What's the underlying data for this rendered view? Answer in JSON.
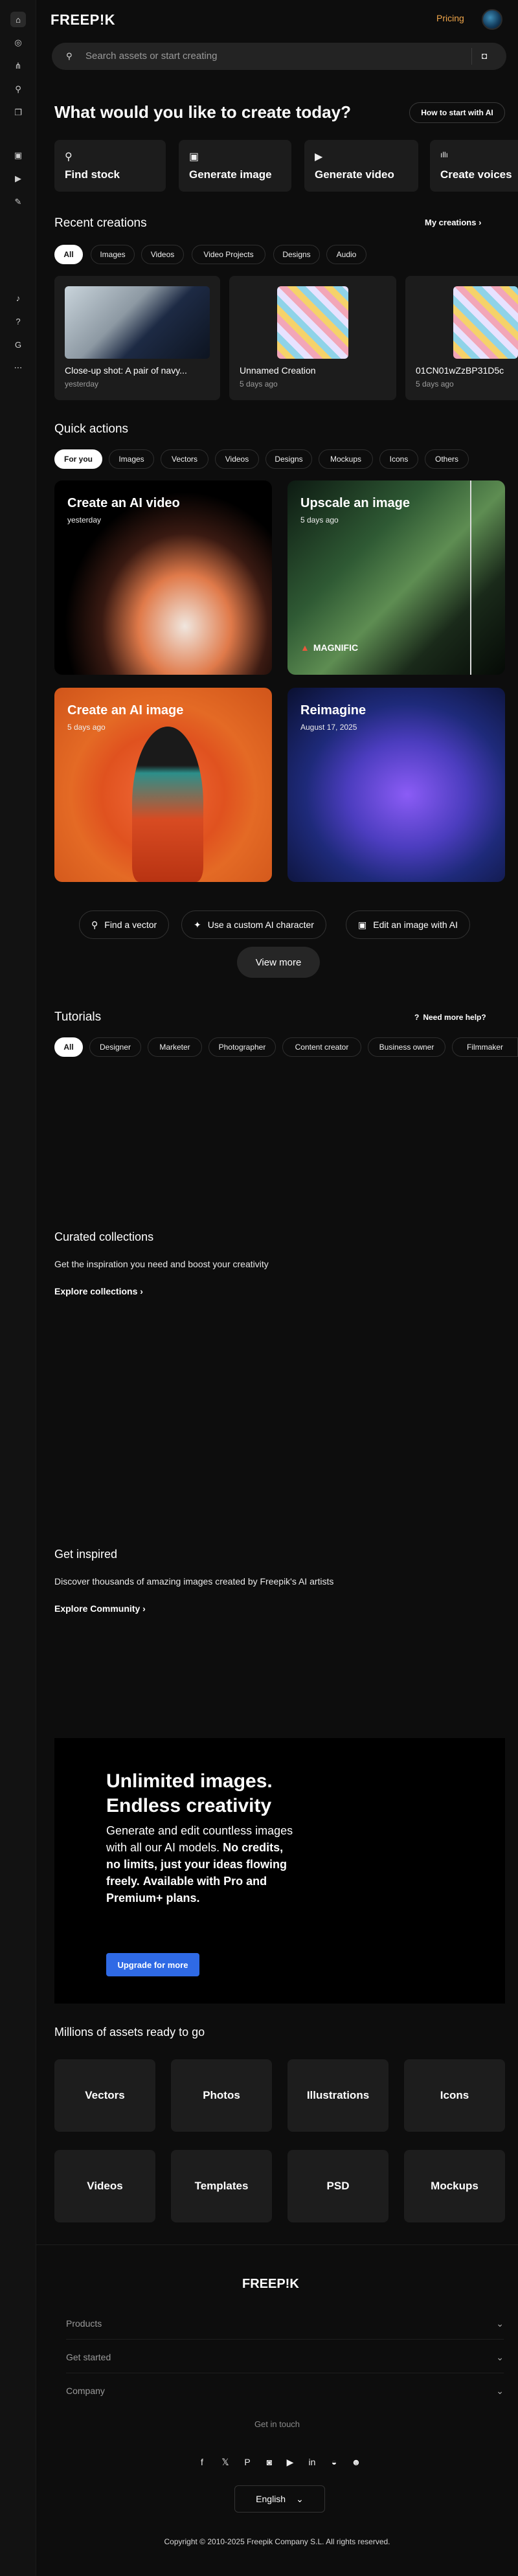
{
  "sidebar": {
    "items": [
      {
        "icon": "home-icon",
        "glyph": "⌂",
        "active": true
      },
      {
        "icon": "globe-icon",
        "glyph": "◎"
      },
      {
        "icon": "share-icon",
        "glyph": "⋔"
      },
      {
        "icon": "search-icon",
        "glyph": "⚲"
      },
      {
        "icon": "layers-icon",
        "glyph": "❐"
      },
      {
        "icon": "image-icon",
        "glyph": "▣"
      },
      {
        "icon": "video-icon",
        "glyph": "▶"
      },
      {
        "icon": "edit-icon",
        "glyph": "✎"
      },
      {
        "icon": "bell-icon",
        "glyph": "♪"
      },
      {
        "icon": "help-icon",
        "glyph": "?"
      },
      {
        "icon": "language-icon",
        "glyph": "G"
      },
      {
        "icon": "more-icon",
        "glyph": "⋯"
      }
    ]
  },
  "header": {
    "logo": "FREEP!K",
    "pricing": "Pricing"
  },
  "search": {
    "placeholder": "Search assets or start creating"
  },
  "create": {
    "title": "What would you like to create today?",
    "how_to": "How to start with AI",
    "cards": [
      {
        "label": "Find stock",
        "icon": "search-icon",
        "glyph": "⚲"
      },
      {
        "label": "Generate image",
        "icon": "image-icon",
        "glyph": "▣"
      },
      {
        "label": "Generate video",
        "icon": "video-icon",
        "glyph": "▶"
      },
      {
        "label": "Create voices",
        "icon": "waveform-icon",
        "glyph": "ıllı"
      }
    ]
  },
  "recent": {
    "title": "Recent creations",
    "my_creations": "My creations",
    "filters": [
      "All",
      "Images",
      "Videos",
      "Video Projects",
      "Designs",
      "Audio"
    ],
    "items": [
      {
        "title": "Close-up shot: A pair of navy...",
        "date": "yesterday"
      },
      {
        "title": "Unnamed Creation",
        "date": "5 days ago"
      },
      {
        "title": "01CN01wZzBP31D5c",
        "date": "5 days ago"
      }
    ]
  },
  "quick": {
    "title": "Quick actions",
    "filters": [
      "For you",
      "Images",
      "Vectors",
      "Videos",
      "Designs",
      "Mockups",
      "Icons",
      "Others"
    ],
    "cards": [
      {
        "title": "Create an AI video",
        "sub": "yesterday"
      },
      {
        "title": "Upscale an image",
        "sub": "5 days ago",
        "badge": "MAGNIFIC"
      },
      {
        "title": "Create an AI image",
        "sub": "5 days ago"
      },
      {
        "title": "Reimagine",
        "sub": "August 17, 2025"
      }
    ],
    "actions": [
      "Find a vector",
      "Use a custom AI character",
      "Edit an image with AI"
    ],
    "view_more": "View more"
  },
  "tutorials": {
    "title": "Tutorials",
    "help": "Need more help?",
    "filters": [
      "All",
      "Designer",
      "Marketer",
      "Photographer",
      "Content creator",
      "Business owner",
      "Filmmaker"
    ]
  },
  "collections": {
    "title": "Curated collections",
    "desc": "Get the inspiration you need and boost your creativity",
    "link": "Explore collections"
  },
  "inspired": {
    "title": "Get inspired",
    "desc": "Discover thousands of amazing images created by Freepik's AI artists",
    "link": "Explore Community"
  },
  "promo": {
    "heading1": "Unlimited images.",
    "heading2": "Endless creativity",
    "p1": "Generate and edit countless images with all our AI models.",
    "p2": "No credits, no limits, just your ideas flowing freely.",
    "p3": "Available with Pro and Premium+ plans.",
    "button": "Upgrade for more"
  },
  "assets": {
    "title": "Millions of assets ready to go",
    "items": [
      "Vectors",
      "Photos",
      "Illustrations",
      "Icons",
      "Videos",
      "Templates",
      "PSD",
      "Mockups"
    ]
  },
  "footer": {
    "logo": "FREEP!K",
    "sections": [
      "Products",
      "Get started",
      "Company"
    ],
    "get_in_touch": "Get in touch",
    "social": [
      {
        "icon": "facebook-icon",
        "glyph": "f"
      },
      {
        "icon": "x-icon",
        "glyph": "𝕏"
      },
      {
        "icon": "pinterest-icon",
        "glyph": "P"
      },
      {
        "icon": "instagram-icon",
        "glyph": "◙"
      },
      {
        "icon": "youtube-icon",
        "glyph": "▶"
      },
      {
        "icon": "linkedin-icon",
        "glyph": "in"
      },
      {
        "icon": "discord-icon",
        "glyph": "◒"
      },
      {
        "icon": "reddit-icon",
        "glyph": "☻"
      }
    ],
    "language": "English",
    "copyright": "Copyright © 2010-2025 Freepik Company S.L. All rights reserved."
  },
  "colors": {
    "accent": "#f0a64a",
    "upgrade": "#2f6ae5",
    "bg": "#0d0d0d",
    "card": "#1c1c1c"
  }
}
